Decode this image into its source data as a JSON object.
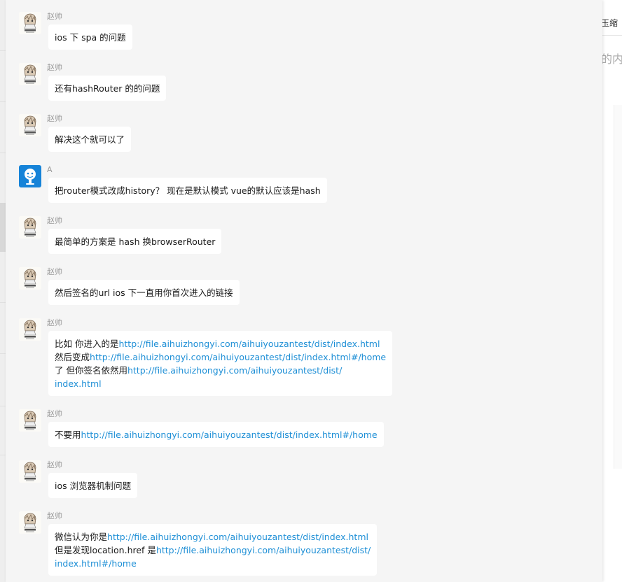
{
  "background": {
    "right_text_top": "玉缩",
    "right_text_mid": "的内"
  },
  "messages": [
    {
      "sender": "赵帅",
      "avatar": "anime-avatar-icon",
      "lines": [
        [
          {
            "t": "text",
            "v": "ios 下 spa 的问题"
          }
        ]
      ]
    },
    {
      "sender": "赵帅",
      "avatar": "anime-avatar-icon",
      "lines": [
        [
          {
            "t": "text",
            "v": "还有hashRouter 的的问题"
          }
        ]
      ]
    },
    {
      "sender": "赵帅",
      "avatar": "anime-avatar-icon",
      "lines": [
        [
          {
            "t": "text",
            "v": "解决这个就可以了"
          }
        ]
      ]
    },
    {
      "sender": "A",
      "avatar": "blue-robot-avatar-icon",
      "lines": [
        [
          {
            "t": "text",
            "v": "把router模式改成history？  现在是默认模式 vue的默认应该是hash"
          }
        ]
      ]
    },
    {
      "sender": "赵帅",
      "avatar": "anime-avatar-icon",
      "lines": [
        [
          {
            "t": "text",
            "v": "最简单的方案是 hash 换browserRouter"
          }
        ]
      ]
    },
    {
      "sender": "赵帅",
      "avatar": "anime-avatar-icon",
      "lines": [
        [
          {
            "t": "text",
            "v": "然后签名的url ios 下一直用你首次进入的链接"
          }
        ]
      ]
    },
    {
      "sender": "赵帅",
      "avatar": "anime-avatar-icon",
      "lines": [
        [
          {
            "t": "text",
            "v": "比如 你进入的是"
          },
          {
            "t": "link",
            "v": "http://file.aihuizhongyi.com/aihuiyouzantest/dist/index.html"
          }
        ],
        [
          {
            "t": "text",
            "v": "然后变成"
          },
          {
            "t": "link",
            "v": "http://file.aihuizhongyi.com/aihuiyouzantest/dist/index.html#/home"
          }
        ],
        [
          {
            "t": "text",
            "v": "了  但你签名依然用"
          },
          {
            "t": "link",
            "v": "http://file.aihuizhongyi.com/aihuiyouzantest/dist/"
          }
        ],
        [
          {
            "t": "link",
            "v": "index.html"
          }
        ]
      ]
    },
    {
      "sender": "赵帅",
      "avatar": "anime-avatar-icon",
      "lines": [
        [
          {
            "t": "text",
            "v": "不要用"
          },
          {
            "t": "link",
            "v": "http://file.aihuizhongyi.com/aihuiyouzantest/dist/index.html#/home"
          }
        ]
      ]
    },
    {
      "sender": "赵帅",
      "avatar": "anime-avatar-icon",
      "lines": [
        [
          {
            "t": "text",
            "v": "ios 浏览器机制问题"
          }
        ]
      ]
    },
    {
      "sender": "赵帅",
      "avatar": "anime-avatar-icon",
      "lines": [
        [
          {
            "t": "text",
            "v": "微信认为你是"
          },
          {
            "t": "link",
            "v": "http://file.aihuizhongyi.com/aihuiyouzantest/dist/index.html"
          }
        ],
        [
          {
            "t": "text",
            "v": "但是发现location.href 是"
          },
          {
            "t": "link",
            "v": "http://file.aihuizhongyi.com/aihuiyouzantest/dist/"
          }
        ],
        [
          {
            "t": "link",
            "v": "index.html#/home"
          }
        ]
      ]
    }
  ],
  "colors": {
    "panel_bg": "#f5f5f5",
    "bubble_bg": "#ffffff",
    "link": "#1e8fd6",
    "sender": "#9a9a9a"
  }
}
